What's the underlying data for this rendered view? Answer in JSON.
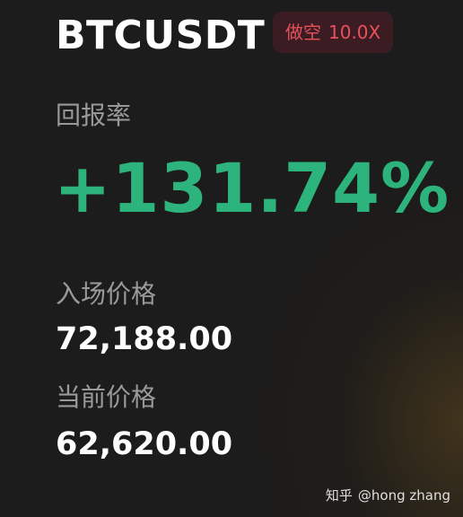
{
  "header": {
    "pair": "BTCUSDT",
    "position_side": "做空",
    "leverage": "10.0X"
  },
  "roi": {
    "label": "回报率",
    "value": "+131.74%"
  },
  "entry_price": {
    "label": "入场价格",
    "value": "72,188.00"
  },
  "current_price": {
    "label": "当前价格",
    "value": "62,620.00"
  },
  "watermark": {
    "site": "知乎",
    "author": "@hong zhang"
  },
  "colors": {
    "background": "#1c1c1c",
    "profit_green": "#2db47c",
    "short_red": "#e8505b",
    "badge_bg": "#3a1c22"
  }
}
